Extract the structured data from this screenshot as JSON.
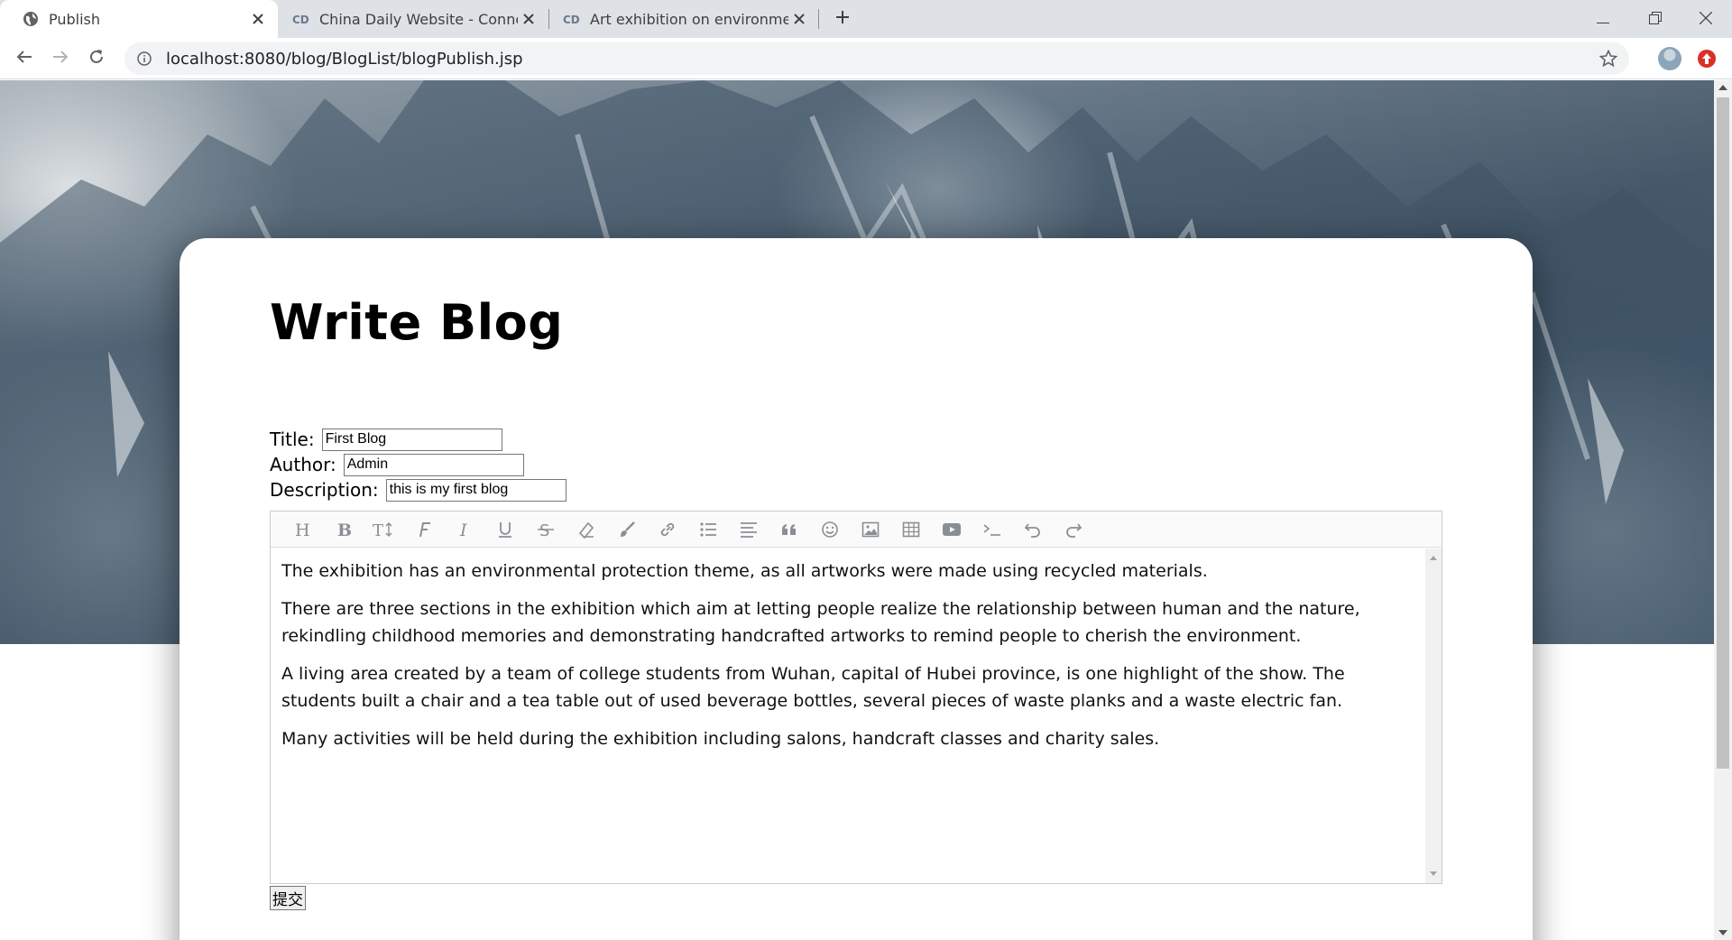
{
  "browser": {
    "tabs": [
      {
        "title": "Publish",
        "icon": "globe-icon",
        "active": true
      },
      {
        "title": "China Daily Website - Connecting China Connecting the World",
        "icon": "china-daily-icon",
        "active": false
      },
      {
        "title": "Art exhibition on environment protection theme",
        "icon": "china-daily-icon",
        "active": false
      }
    ],
    "url": "localhost:8080/blog/BlogList/blogPublish.jsp"
  },
  "page": {
    "heading": "Write Blog",
    "form": {
      "title_label": "Title:",
      "title_value": "First Blog",
      "author_label": "Author:",
      "author_value": "Admin",
      "description_label": "Description:",
      "description_value": "this is my first blog"
    },
    "editor": {
      "toolbar_icons": [
        "heading-icon",
        "bold-icon",
        "font-size-icon",
        "font-family-icon",
        "italic-icon",
        "underline-icon",
        "strikethrough-icon",
        "eraser-icon",
        "brush-icon",
        "link-icon",
        "list-icon",
        "align-icon",
        "quote-icon",
        "emoji-icon",
        "image-icon",
        "table-icon",
        "video-icon",
        "code-icon",
        "undo-icon",
        "redo-icon"
      ],
      "paragraphs": [
        "The exhibition has an environmental protection theme, as all artworks were made using recycled materials.",
        "There are three sections in the exhibition which aim at letting people realize the relationship between human and the nature, rekindling childhood memories and demonstrating handcrafted artworks to remind people to cherish the environment.",
        "A living area created by a team of college students from Wuhan, capital of Hubei province, is one highlight of the show. The students built a chair and a tea table out of used beverage bottles, several pieces of waste planks and a waste electric fan.",
        "Many activities will be held during the exhibition including salons, handcraft classes and charity sales."
      ]
    },
    "submit_label": "提交"
  }
}
